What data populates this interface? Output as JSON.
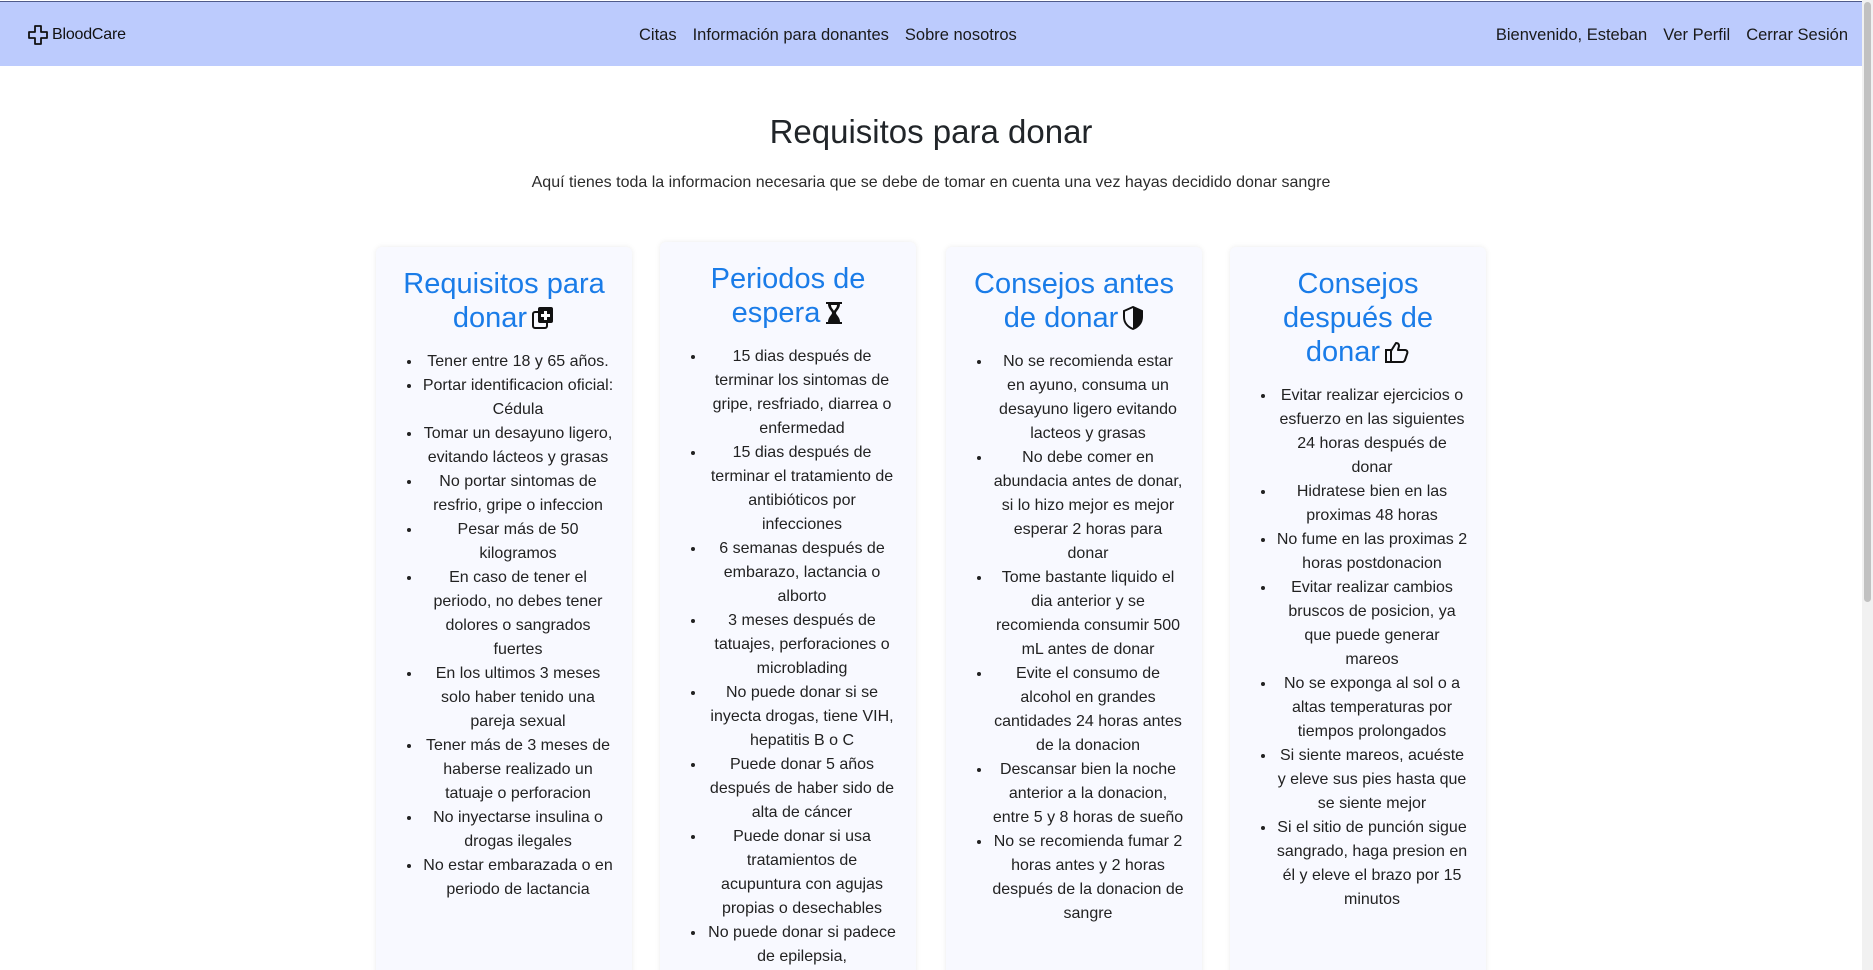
{
  "navbar": {
    "brand": "BloodCare",
    "links": [
      "Citas",
      "Información para donantes",
      "Sobre nosotros"
    ],
    "welcome": "Bienvenido, Esteban",
    "profile": "Ver Perfil",
    "logout": "Cerrar Sesión"
  },
  "header": {
    "title": "Requisitos para donar",
    "subtitle": "Aquí tienes toda la informacion necesaria que se debe de tomar en cuenta una vez hayas decidido donar sangre"
  },
  "cards": [
    {
      "title": "Requisitos para donar",
      "icon": "medical-copy-icon",
      "items": [
        "Tener entre 18 y 65 años.",
        "Portar identificacion oficial: Cédula",
        "Tomar un desayuno ligero, evitando lácteos y grasas",
        "No portar sintomas de resfrio, gripe o infeccion",
        "Pesar más de 50 kilogramos",
        "En caso de tener el periodo, no debes tener dolores o sangrados fuertes",
        "En los ultimos 3 meses solo haber tenido una pareja sexual",
        "Tener más de 3 meses de haberse realizado un tatuaje o perforacion",
        "No inyectarse insulina o drogas ilegales",
        "No estar embarazada o en periodo de lactancia"
      ]
    },
    {
      "title": "Periodos de espera",
      "icon": "hourglass-icon",
      "items": [
        "15 dias después de terminar los sintomas de gripe, resfriado, diarrea o enfermedad",
        "15 dias después de terminar el tratamiento de antibióticos por infecciones",
        "6 semanas después de embarazo, lactancia o alborto",
        "3 meses después de tatuajes, perforaciones o microblading",
        "No puede donar si se inyecta drogas, tiene VIH, hepatitis B o C",
        "Puede donar 5 años después de haber sido de alta de cáncer",
        "Puede donar si usa tratamientos de acupuntura con agujas propias o desechables",
        "No puede donar si padece de epilepsia,"
      ]
    },
    {
      "title": "Consejos antes de donar",
      "icon": "shield-icon",
      "items": [
        "No se recomienda estar en ayuno, consuma un desayuno ligero evitando lacteos y grasas",
        "No debe comer en abundacia antes de donar, si lo hizo mejor es mejor esperar 2 horas para donar",
        "Tome bastante liquido el dia anterior y se recomienda consumir 500 mL antes de donar",
        "Evite el consumo de alcohol en grandes cantidades 24 horas antes de la donacion",
        "Descansar bien la noche anterior a la donacion, entre 5 y 8 horas de sueño",
        "No se recomienda fumar 2 horas antes y 2 horas después de la donacion de sangre"
      ]
    },
    {
      "title": "Consejos después de donar",
      "icon": "thumbs-up-icon",
      "items": [
        "Evitar realizar ejercicios o esfuerzo en las siguientes 24 horas después de donar",
        "Hidratese bien en las proximas 48 horas",
        "No fume en las proximas 2 horas postdonacion",
        "Evitar realizar cambios bruscos de posicion, ya que puede generar mareos",
        "No se exponga al sol o a altas temperaturas por tiempos prolongados",
        "Si siente mareos, acuéste y eleve sus pies hasta que se siente mejor",
        "Si el sitio de punción sigue sangrado, haga presion en él y eleve el brazo por 15 minutos"
      ]
    }
  ]
}
